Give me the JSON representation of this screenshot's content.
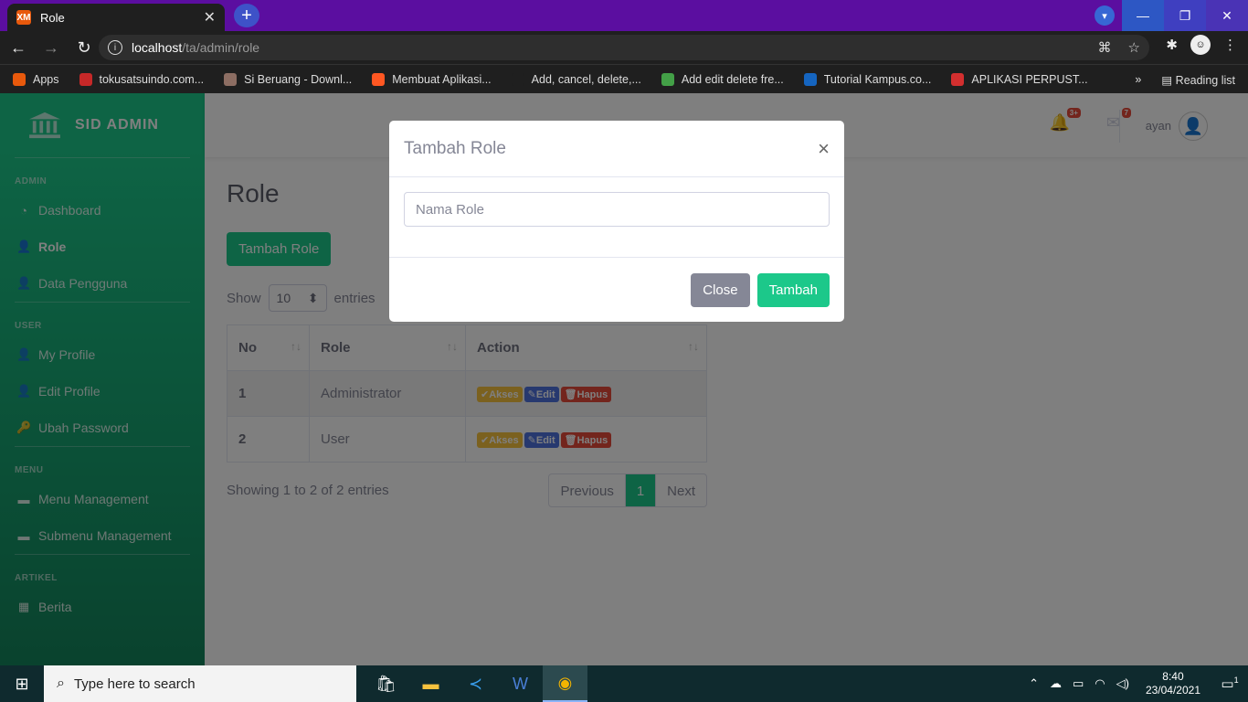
{
  "browser": {
    "tab_title": "Role",
    "tab_favicon": "XM",
    "new_tab": "+",
    "url_host": "localhost",
    "url_path": "/ta/admin/role",
    "bookmarks": [
      {
        "label": "Apps",
        "color": "#e8590c"
      },
      {
        "label": "tokusatsuindo.com...",
        "color": "#c62828"
      },
      {
        "label": "Si Beruang - Downl...",
        "color": "#8d6e63"
      },
      {
        "label": "Membuat Aplikasi...",
        "color": "#ff5722"
      },
      {
        "label": "Add, cancel, delete,...",
        "color": "#1f1f1f"
      },
      {
        "label": "Add edit delete fre...",
        "color": "#43a047"
      },
      {
        "label": "Tutorial Kampus.co...",
        "color": "#1565c0"
      },
      {
        "label": "APLIKASI PERPUST...",
        "color": "#d32f2f"
      }
    ],
    "bookmarks_more": "»",
    "reading_list": "Reading list"
  },
  "sidebar": {
    "brand": "SID ADMIN",
    "sections": [
      {
        "heading": "ADMIN",
        "items": [
          {
            "label": "Dashboard",
            "icon": "tachometer-icon",
            "glyph": "◔",
            "active": false
          },
          {
            "label": "Role",
            "icon": "user-tie-icon",
            "glyph": "👤",
            "active": true
          },
          {
            "label": "Data Pengguna",
            "icon": "user-edit-icon",
            "glyph": "👤",
            "active": false
          }
        ]
      },
      {
        "heading": "USER",
        "items": [
          {
            "label": "My Profile",
            "icon": "user-icon",
            "glyph": "👤",
            "active": false
          },
          {
            "label": "Edit Profile",
            "icon": "user-edit-icon",
            "glyph": "👤",
            "active": false
          },
          {
            "label": "Ubah Password",
            "icon": "key-icon",
            "glyph": "🔑",
            "active": false
          }
        ]
      },
      {
        "heading": "MENU",
        "items": [
          {
            "label": "Menu Management",
            "icon": "folder-icon",
            "glyph": "▬",
            "active": false
          },
          {
            "label": "Submenu Management",
            "icon": "folder-open-icon",
            "glyph": "▬",
            "active": false
          }
        ]
      },
      {
        "heading": "ARTIKEL",
        "items": [
          {
            "label": "Berita",
            "icon": "calendar-icon",
            "glyph": "▦",
            "active": false
          }
        ]
      }
    ]
  },
  "topbar": {
    "alerts_badge": "3+",
    "messages_badge": "7",
    "username": "ayan"
  },
  "main": {
    "page_title": "Role",
    "add_button": "Tambah Role",
    "show_label": "Show",
    "entries_value": "10",
    "entries_label": "entries",
    "columns": [
      "No",
      "Role",
      "Action"
    ],
    "rows": [
      {
        "no": "1",
        "role": "Administrator"
      },
      {
        "no": "2",
        "role": "User"
      }
    ],
    "actions": {
      "akses": "✔Akses",
      "edit": "✎Edit",
      "hapus": "🗑Hapus"
    },
    "info": "Showing 1 to 2 of 2 entries",
    "pager": {
      "previous": "Previous",
      "current": "1",
      "next": "Next"
    }
  },
  "modal": {
    "title": "Tambah Role",
    "close_x": "×",
    "input_placeholder": "Nama Role",
    "close_button": "Close",
    "submit_button": "Tambah"
  },
  "taskbar": {
    "search_placeholder": "Type here to search",
    "time": "8:40",
    "date": "23/04/2021",
    "notifications": "1"
  }
}
